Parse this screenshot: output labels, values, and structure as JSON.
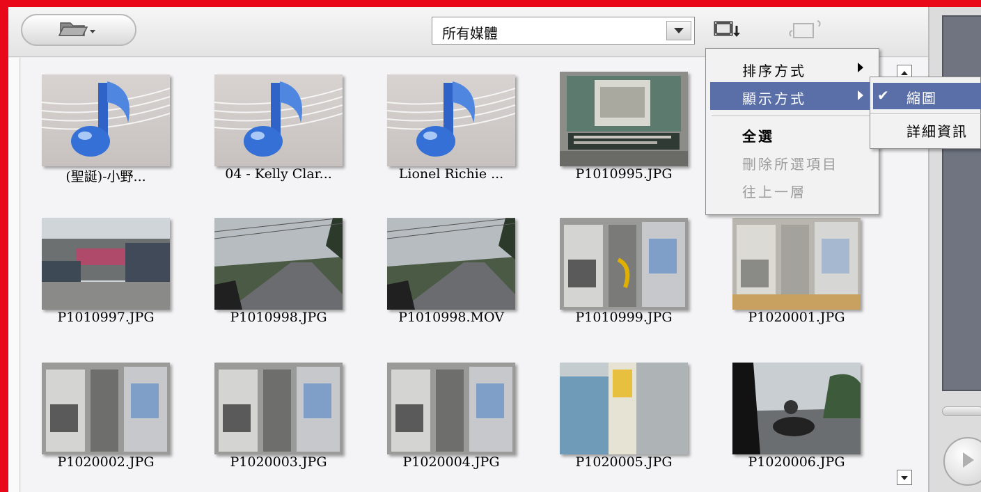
{
  "toolbar": {
    "folder_icon": "folder-open-icon",
    "media_filter": {
      "selected": "所有媒體"
    },
    "sort_icon": "sort-filmstrip-icon",
    "repeat_icon": "repeat-filmstrip-icon"
  },
  "grid": {
    "items": [
      {
        "caption": "(聖誕)-小野...",
        "kind": "music"
      },
      {
        "caption": "04 - Kelly Clar...",
        "kind": "music"
      },
      {
        "caption": "Lionel Richie ...",
        "kind": "music"
      },
      {
        "caption": "P1010995.JPG",
        "kind": "photo"
      },
      {
        "caption": "P1010997.JPG",
        "kind": "photo"
      },
      {
        "caption": "P1010998.JPG",
        "kind": "photo"
      },
      {
        "caption": "P1010998.MOV",
        "kind": "video"
      },
      {
        "caption": "P1010999.JPG",
        "kind": "photo"
      },
      {
        "caption": "P1020001.JPG",
        "kind": "photo"
      },
      {
        "caption": "P1020002.JPG",
        "kind": "photo"
      },
      {
        "caption": "P1020003.JPG",
        "kind": "photo"
      },
      {
        "caption": "P1020004.JPG",
        "kind": "photo"
      },
      {
        "caption": "P1020005.JPG",
        "kind": "photo"
      },
      {
        "caption": "P1020006.JPG",
        "kind": "photo"
      }
    ]
  },
  "context_menu": {
    "items": [
      {
        "label": "排序方式",
        "submenu": true,
        "state": "normal"
      },
      {
        "label": "顯示方式",
        "submenu": true,
        "state": "highlighted"
      },
      {
        "label": "全選",
        "submenu": false,
        "state": "bold"
      },
      {
        "label": "刪除所選項目",
        "submenu": false,
        "state": "disabled"
      },
      {
        "label": "往上一層",
        "submenu": false,
        "state": "disabled"
      }
    ]
  },
  "submenu": {
    "items": [
      {
        "label": "縮圖",
        "checked": true,
        "state": "highlighted"
      },
      {
        "label": "詳細資訊",
        "checked": false,
        "state": "normal"
      }
    ]
  },
  "colors": {
    "frame_border": "#e8081a",
    "menu_highlight": "#5a6fa8"
  }
}
